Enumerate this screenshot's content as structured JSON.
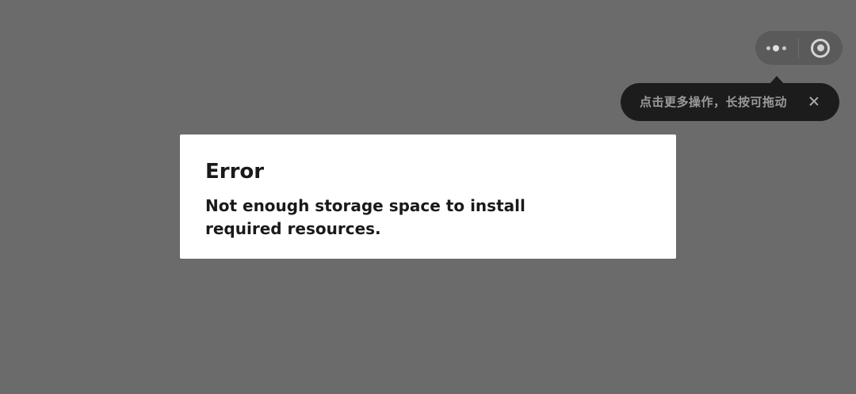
{
  "capsule": {
    "more_icon": "more-dots-icon",
    "close_icon": "target-circle-icon"
  },
  "tooltip": {
    "text": "点击更多操作，长按可拖动",
    "close_icon": "close-icon"
  },
  "dialog": {
    "title": "Error",
    "message": "Not enough storage space to install required resources."
  },
  "colors": {
    "overlay": "#6b6b6b",
    "dialog_bg": "#ffffff",
    "tooltip_bg": "#1c1c1c",
    "capsule_bg": "#5a5a5a"
  }
}
